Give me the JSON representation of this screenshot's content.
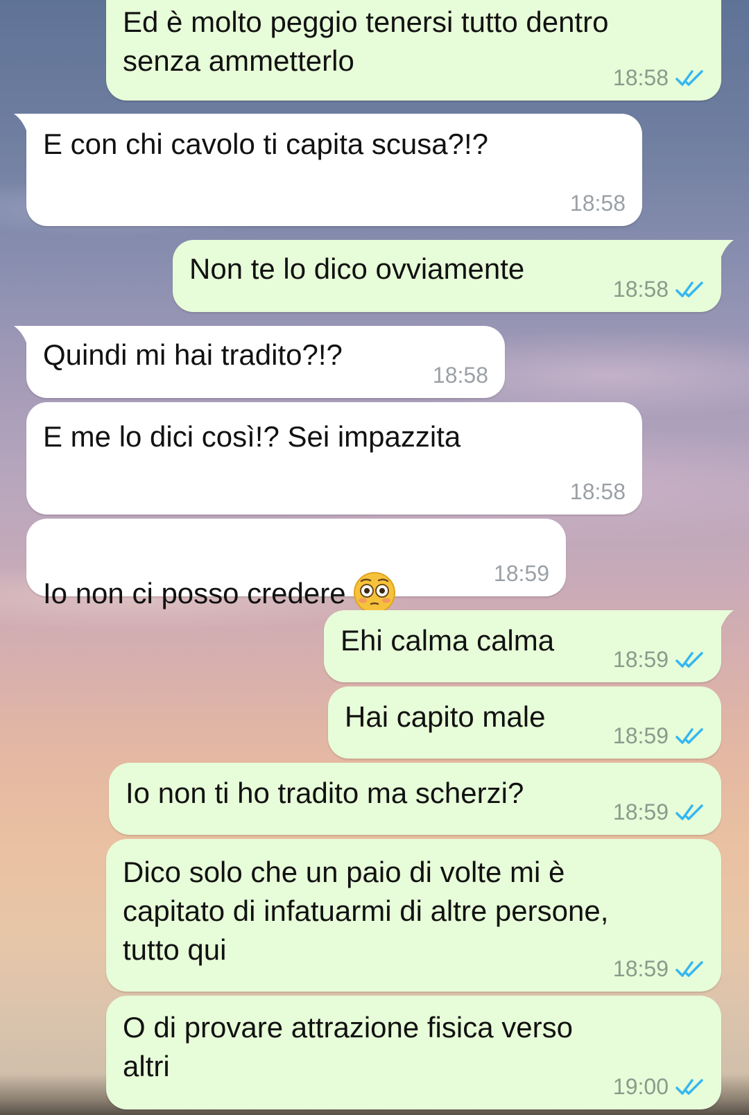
{
  "colors": {
    "incoming_bubble": "#ffffff",
    "outgoing_bubble": "#e7fcd8",
    "read_ticks": "#34b7f1"
  },
  "messages": [
    {
      "direction": "out",
      "text": "Ed è molto peggio tenersi tutto dentro\nsenza ammetterlo",
      "time": "18:58",
      "status": "read-ticks-icon"
    },
    {
      "direction": "in",
      "text": "E con chi cavolo ti capita scusa?!?",
      "time": "18:58"
    },
    {
      "direction": "out",
      "text": "Non te lo dico ovviamente",
      "time": "18:58",
      "status": "read-ticks-icon"
    },
    {
      "direction": "in",
      "text": "Quindi mi hai tradito?!?",
      "time": "18:58"
    },
    {
      "direction": "in",
      "text": "E me lo dici così!? Sei impazzita",
      "time": "18:58"
    },
    {
      "direction": "in",
      "text": "Io non ci posso credere",
      "emoji": "flushed-face-icon",
      "time": "18:59"
    },
    {
      "direction": "out",
      "text": "Ehi calma calma",
      "time": "18:59",
      "status": "read-ticks-icon"
    },
    {
      "direction": "out",
      "text": "Hai capito male",
      "time": "18:59",
      "status": "read-ticks-icon"
    },
    {
      "direction": "out",
      "text": "Io non ti ho tradito ma scherzi?",
      "time": "18:59",
      "status": "read-ticks-icon"
    },
    {
      "direction": "out",
      "text": "Dico solo che un paio di volte mi è\ncapitato di infatuarmi di altre persone,\ntutto qui",
      "time": "18:59",
      "status": "read-ticks-icon"
    },
    {
      "direction": "out",
      "text": "O di provare attrazione fisica verso\naltri",
      "time": "19:00",
      "status": "read-ticks-icon"
    }
  ]
}
